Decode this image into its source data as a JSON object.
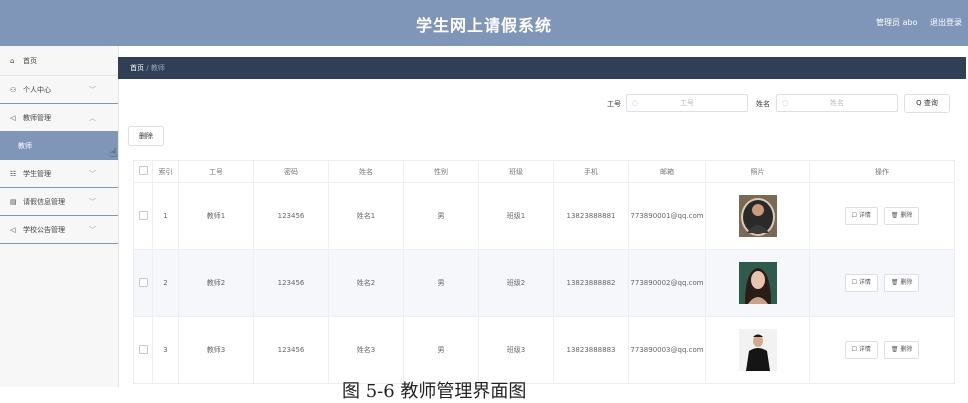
{
  "header": {
    "title": "学生网上请假系统",
    "user_label": "管理员 abo",
    "logout_label": "退出登录"
  },
  "sidebar": {
    "items": [
      {
        "icon": "home-icon",
        "label": "首页",
        "chevron": ""
      },
      {
        "icon": "user-icon",
        "label": "个人中心",
        "chevron": "﹀"
      },
      {
        "icon": "send-icon",
        "label": "教师管理",
        "chevron": "︿"
      },
      {
        "icon": "",
        "label": "教师",
        "chevron": ""
      },
      {
        "icon": "grid-icon",
        "label": "学生管理",
        "chevron": "﹀"
      },
      {
        "icon": "trash-icon",
        "label": "请假信息管理",
        "chevron": "﹀"
      },
      {
        "icon": "send-icon",
        "label": "学校公告管理",
        "chevron": "﹀"
      }
    ]
  },
  "breadcrumb": {
    "home": "首页",
    "sep": "/",
    "current": "教师"
  },
  "search": {
    "id_label": "工号",
    "id_placeholder": "工号",
    "name_label": "姓名",
    "name_placeholder": "姓名",
    "query_label": "Q 查询"
  },
  "toolbar": {
    "delete_label": "删除"
  },
  "table": {
    "headers": [
      "",
      "索引",
      "工号",
      "密码",
      "姓名",
      "性别",
      "班级",
      "手机",
      "邮箱",
      "照片",
      "操作"
    ],
    "rows": [
      {
        "index": "1",
        "id": "教师1",
        "password": "123456",
        "name": "姓名1",
        "gender": "男",
        "class": "班级1",
        "phone": "13823888881",
        "email": "773890001@qq.com"
      },
      {
        "index": "2",
        "id": "教师2",
        "password": "123456",
        "name": "姓名2",
        "gender": "男",
        "class": "班级2",
        "phone": "13823888882",
        "email": "773890002@qq.com"
      },
      {
        "index": "3",
        "id": "教师3",
        "password": "123456",
        "name": "姓名3",
        "gender": "男",
        "class": "班级3",
        "phone": "13823888883",
        "email": "773890003@qq.com"
      }
    ],
    "detail_label": "☐ 详情",
    "row_delete_label": "🗑 删除"
  },
  "caption": "图 5-6 教师管理界面图",
  "colors": {
    "header_bg": "#7f96b8",
    "breadcrumb_bg": "#2f4056",
    "active_item_bg": "#7f96b8"
  }
}
